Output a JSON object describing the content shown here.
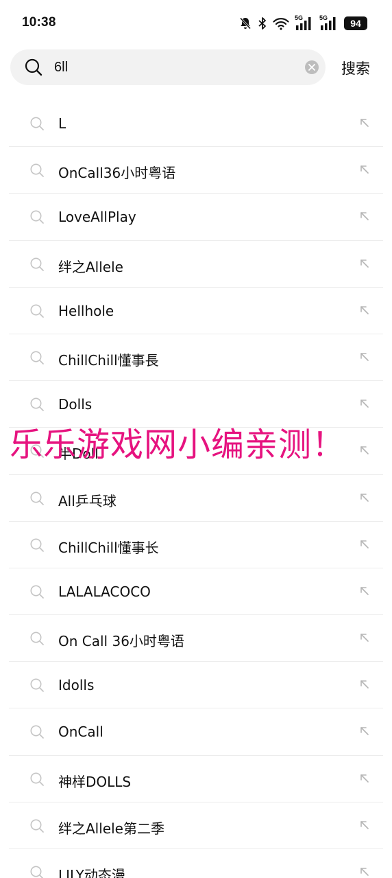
{
  "status_bar": {
    "time": "10:38",
    "battery": "94",
    "network_label_1": "5G",
    "network_label_2": "5G"
  },
  "search": {
    "query": "6ll",
    "submit_label": "搜索"
  },
  "suggestions": [
    "L",
    "OnCall36小时粤语",
    "LoveAllPlay",
    "绊之Allele",
    "Hellhole",
    "ChillChill懂事長",
    "Dolls",
    "半Doll",
    "All乒乓球",
    "ChillChill懂事长",
    "LALALACOCO",
    "On Call 36小时粤语",
    "Idolls",
    "OnCall",
    "神样DOLLS",
    "绊之Allele第二季",
    "LILY动态漫"
  ],
  "watermark": "乐乐游戏网小编亲测！",
  "colors": {
    "watermark": "#e6137f",
    "search_bg": "#f2f2f2",
    "icon_gray": "#bdbdbd"
  }
}
